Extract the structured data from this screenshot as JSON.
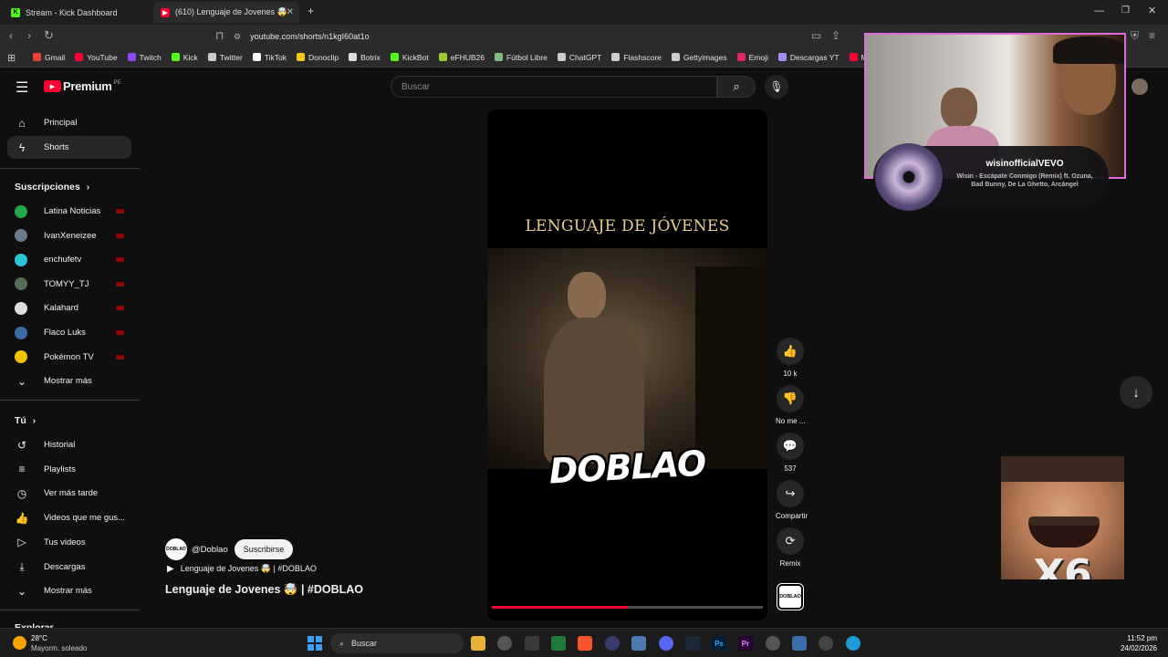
{
  "browser": {
    "tabs": [
      {
        "label": "Stream - Kick Dashboard",
        "icon": "kick-icon",
        "color": "#53fc18"
      },
      {
        "label": "(610) Lenguaje de Jovenes 🤯",
        "icon": "youtube-icon",
        "color": "#ff0033"
      }
    ],
    "new_tab": "+",
    "url": "youtube.com/shorts/n1kgI60at1o",
    "bookmarks": [
      {
        "label": "Gmail",
        "color": "#ea4335"
      },
      {
        "label": "YouTube",
        "color": "#ff0033"
      },
      {
        "label": "Twitch",
        "color": "#9146ff"
      },
      {
        "label": "Kick",
        "color": "#53fc18"
      },
      {
        "label": "Twitter",
        "color": "#cccccc"
      },
      {
        "label": "TikTok",
        "color": "#ffffff"
      },
      {
        "label": "Donoclip",
        "color": "#f5c518"
      },
      {
        "label": "Botrix",
        "color": "#dddddd"
      },
      {
        "label": "KickBot",
        "color": "#53fc18"
      },
      {
        "label": "eFHUB26",
        "color": "#9acd32"
      },
      {
        "label": "Fútbol Libre",
        "color": "#7fbf7f"
      },
      {
        "label": "ChatGPT",
        "color": "#cccccc"
      },
      {
        "label": "Flashscore",
        "color": "#cccccc"
      },
      {
        "label": "Gettyimages",
        "color": "#cccccc"
      },
      {
        "label": "Emoji",
        "color": "#e0245e"
      },
      {
        "label": "Descargas YT",
        "color": "#a78bfa"
      },
      {
        "label": "Mix M",
        "color": "#ff0033"
      }
    ]
  },
  "youtube": {
    "logo": "Premium",
    "logo_region": "PE",
    "search_placeholder": "Buscar",
    "nav": [
      {
        "label": "Principal",
        "icon": "home-icon"
      },
      {
        "label": "Shorts",
        "icon": "shorts-icon"
      }
    ],
    "subscriptions_title": "Suscripciones",
    "subscriptions": [
      {
        "label": "Latina Noticias",
        "color": "#22a84a"
      },
      {
        "label": "IvanXeneizee",
        "color": "#6b7b8c"
      },
      {
        "label": "enchufetv",
        "color": "#29c6d6"
      },
      {
        "label": "TOMYY_TJ",
        "color": "#556b55"
      },
      {
        "label": "Kalahard",
        "color": "#dddddd"
      },
      {
        "label": "Flaco Luks",
        "color": "#3b6ea8"
      },
      {
        "label": "Pokémon TV",
        "color": "#f2c200"
      }
    ],
    "show_more": "Mostrar más",
    "you_title": "Tú",
    "you_items": [
      {
        "label": "Historial",
        "icon": "history-icon"
      },
      {
        "label": "Playlists",
        "icon": "playlist-icon"
      },
      {
        "label": "Ver más tarde",
        "icon": "clock-icon"
      },
      {
        "label": "Videos que me gus...",
        "icon": "thumbs-up-icon"
      },
      {
        "label": "Tus videos",
        "icon": "your-videos-icon"
      },
      {
        "label": "Descargas",
        "icon": "download-icon"
      }
    ],
    "show_more_2": "Mostrar más",
    "explore_title": "Explorar",
    "short": {
      "title_overlay": "LENGUAJE DE JÓVENES",
      "brand_overlay": "DOBLAO",
      "channel": "@Doblao",
      "subscribe": "Suscribirse",
      "playlist_line": "Lenguaje de Jovenes 🤯 | #DOBLAO",
      "title": "Lenguaje de Jovenes 🤯 | #DOBLAO",
      "progress": 0.5,
      "actions": [
        {
          "label": "10 k",
          "icon": "like-icon"
        },
        {
          "label": "No me ...",
          "icon": "dislike-icon"
        },
        {
          "label": "537",
          "icon": "comment-icon"
        },
        {
          "label": "Compartir",
          "icon": "share-icon"
        },
        {
          "label": "Remix",
          "icon": "remix-icon"
        }
      ]
    }
  },
  "overlay": {
    "music_channel": "wisinofficialVEVO",
    "music_track": "Wisin - Escápate Conmigo (Remix) ft. Ozuna, Bad Bunny, De La Ghetto, Arcángel",
    "emote_text": "X6"
  },
  "taskbar": {
    "weather_temp": "28°C",
    "weather_desc": "Mayorm. soleado",
    "search": "Buscar",
    "time": "11:52 pm",
    "date": "24/02/2026"
  }
}
